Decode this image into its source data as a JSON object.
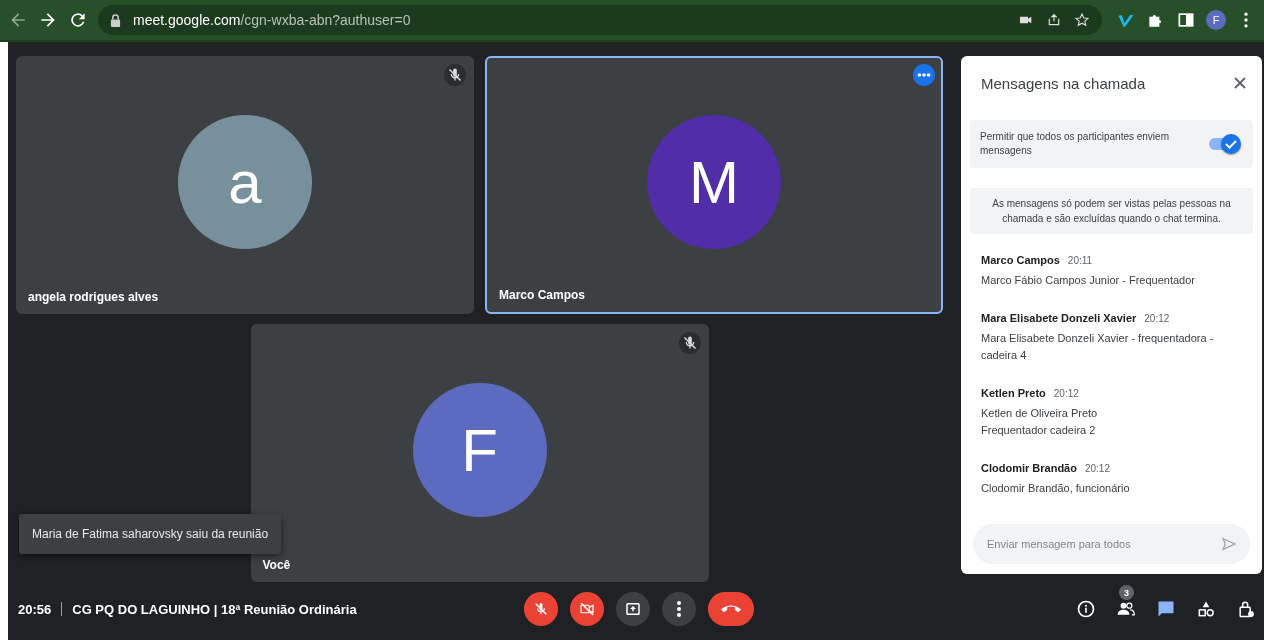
{
  "browser": {
    "url_host": "meet.google.com",
    "url_path": "/cgn-wxba-abn?authuser=0",
    "profile_initial": "F"
  },
  "tiles": [
    {
      "name": "angela rodrigues alves",
      "initial": "a",
      "color": "#78909c",
      "muted": true,
      "highlighted": false
    },
    {
      "name": "Marco Campos",
      "initial": "M",
      "color": "#512da8",
      "muted": false,
      "highlighted": true
    },
    {
      "name": "Você",
      "initial": "F",
      "color": "#5c6bc0",
      "muted": true,
      "highlighted": false
    }
  ],
  "toast": "Maria de Fatima saharovsky saiu da reunião",
  "chat": {
    "title": "Mensagens na chamada",
    "permission": {
      "label": "Permitir que todos os participantes enviem mensagens",
      "on": true
    },
    "notice": "As mensagens só podem ser vistas pelas pessoas na chamada e são excluídas quando o chat termina.",
    "messages": [
      {
        "sender": "Marco Campos",
        "time": "20:11",
        "lines": [
          "Marco Fábio Campos Junior - Frequentador"
        ]
      },
      {
        "sender": "Mara Elisabete Donzeli Xavier",
        "time": "20:12",
        "lines": [
          "Mara Elisabete Donzeli Xavier - frequentadora - cadeira 4"
        ]
      },
      {
        "sender": "Ketlen Preto",
        "time": "20:12",
        "lines": [
          "Ketlen de Oliveira Preto",
          "Frequentador cadeira 2"
        ]
      },
      {
        "sender": "Clodomir Brandão",
        "time": "20:12",
        "lines": [
          "Clodomir Brandão, funcionário"
        ]
      }
    ],
    "input": {
      "placeholder": "Enviar mensagem para todos"
    }
  },
  "bottom": {
    "time": "20:56",
    "meeting": "CG PQ DO LAGUINHO | 18ª Reunião Ordinária",
    "controls": [
      {
        "kind": "mic",
        "off": true
      },
      {
        "kind": "camera",
        "off": true
      },
      {
        "kind": "present",
        "off": false
      },
      {
        "kind": "more",
        "off": false
      },
      {
        "kind": "hangup",
        "off": true
      }
    ],
    "people_count": "3",
    "chat_selected": true
  }
}
